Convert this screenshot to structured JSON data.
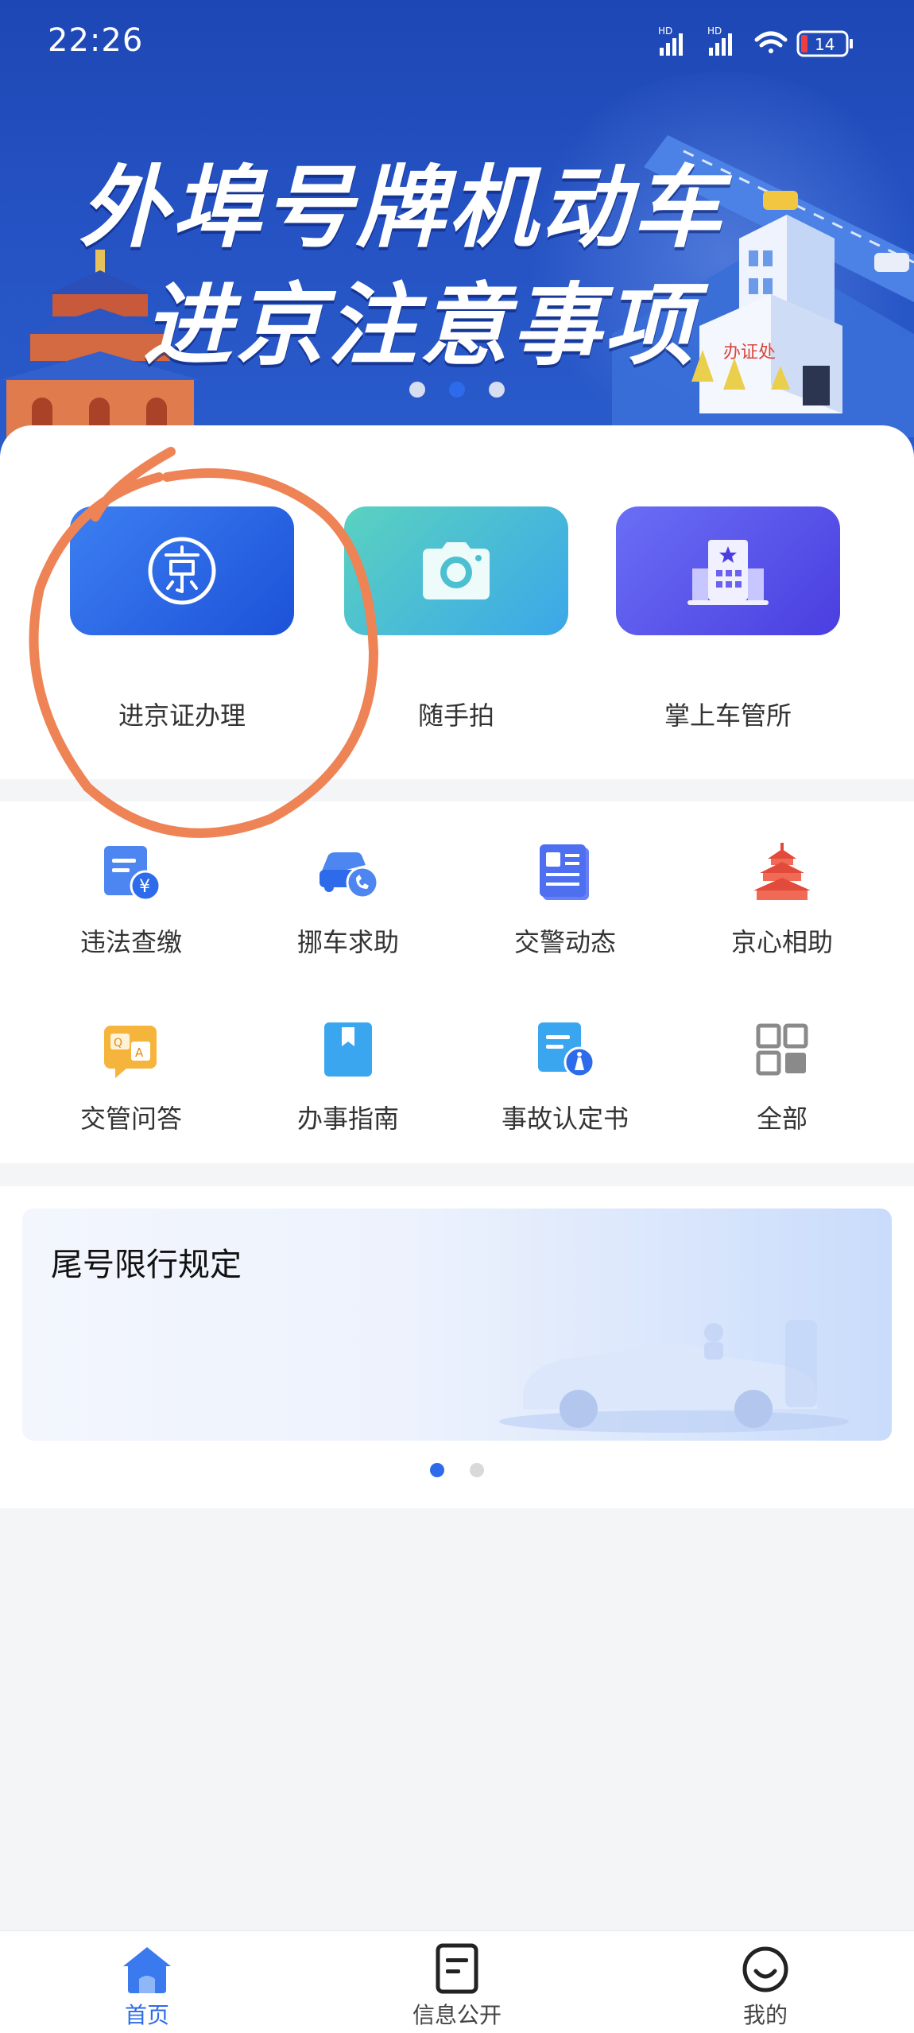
{
  "status_bar": {
    "time": "22:26",
    "battery": "14"
  },
  "banner": {
    "title_line1": "外埠号牌机动车",
    "title_line2": "进京注意事项",
    "building_sign": "办证处",
    "page_count": 3,
    "active_page": 2
  },
  "services": [
    {
      "label": "进京证办理",
      "icon": "jing-emblem-icon"
    },
    {
      "label": "随手拍",
      "icon": "camera-icon"
    },
    {
      "label": "掌上车管所",
      "icon": "building-star-icon"
    }
  ],
  "grid": [
    {
      "label": "违法查缴",
      "icon": "fine-payment-icon"
    },
    {
      "label": "挪车求助",
      "icon": "car-phone-icon"
    },
    {
      "label": "交警动态",
      "icon": "news-icon"
    },
    {
      "label": "京心相助",
      "icon": "temple-icon"
    },
    {
      "label": "交管问答",
      "icon": "qa-icon"
    },
    {
      "label": "办事指南",
      "icon": "guide-bookmark-icon"
    },
    {
      "label": "事故认定书",
      "icon": "accident-report-icon"
    },
    {
      "label": "全部",
      "icon": "all-grid-icon"
    }
  ],
  "promo": {
    "title": "尾号限行规定",
    "page_count": 2,
    "active_page": 1
  },
  "bottom_nav": [
    {
      "label": "首页",
      "icon": "home-icon",
      "active": true
    },
    {
      "label": "信息公开",
      "icon": "document-icon",
      "active": false
    },
    {
      "label": "我的",
      "icon": "smiley-icon",
      "active": false
    }
  ],
  "colors": {
    "brand_blue": "#2d6bea",
    "banner_blue": "#2552c3",
    "annotation_orange": "#ee8356"
  }
}
